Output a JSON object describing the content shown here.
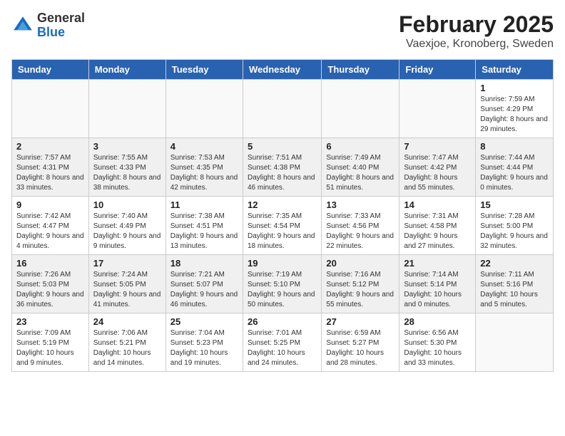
{
  "logo": {
    "general": "General",
    "blue": "Blue"
  },
  "title": "February 2025",
  "subtitle": "Vaexjoe, Kronoberg, Sweden",
  "headers": [
    "Sunday",
    "Monday",
    "Tuesday",
    "Wednesday",
    "Thursday",
    "Friday",
    "Saturday"
  ],
  "weeks": [
    [
      {
        "day": "",
        "info": ""
      },
      {
        "day": "",
        "info": ""
      },
      {
        "day": "",
        "info": ""
      },
      {
        "day": "",
        "info": ""
      },
      {
        "day": "",
        "info": ""
      },
      {
        "day": "",
        "info": ""
      },
      {
        "day": "1",
        "info": "Sunrise: 7:59 AM\nSunset: 4:29 PM\nDaylight: 8 hours and 29 minutes."
      }
    ],
    [
      {
        "day": "2",
        "info": "Sunrise: 7:57 AM\nSunset: 4:31 PM\nDaylight: 8 hours and 33 minutes."
      },
      {
        "day": "3",
        "info": "Sunrise: 7:55 AM\nSunset: 4:33 PM\nDaylight: 8 hours and 38 minutes."
      },
      {
        "day": "4",
        "info": "Sunrise: 7:53 AM\nSunset: 4:35 PM\nDaylight: 8 hours and 42 minutes."
      },
      {
        "day": "5",
        "info": "Sunrise: 7:51 AM\nSunset: 4:38 PM\nDaylight: 8 hours and 46 minutes."
      },
      {
        "day": "6",
        "info": "Sunrise: 7:49 AM\nSunset: 4:40 PM\nDaylight: 8 hours and 51 minutes."
      },
      {
        "day": "7",
        "info": "Sunrise: 7:47 AM\nSunset: 4:42 PM\nDaylight: 8 hours and 55 minutes."
      },
      {
        "day": "8",
        "info": "Sunrise: 7:44 AM\nSunset: 4:44 PM\nDaylight: 9 hours and 0 minutes."
      }
    ],
    [
      {
        "day": "9",
        "info": "Sunrise: 7:42 AM\nSunset: 4:47 PM\nDaylight: 9 hours and 4 minutes."
      },
      {
        "day": "10",
        "info": "Sunrise: 7:40 AM\nSunset: 4:49 PM\nDaylight: 9 hours and 9 minutes."
      },
      {
        "day": "11",
        "info": "Sunrise: 7:38 AM\nSunset: 4:51 PM\nDaylight: 9 hours and 13 minutes."
      },
      {
        "day": "12",
        "info": "Sunrise: 7:35 AM\nSunset: 4:54 PM\nDaylight: 9 hours and 18 minutes."
      },
      {
        "day": "13",
        "info": "Sunrise: 7:33 AM\nSunset: 4:56 PM\nDaylight: 9 hours and 22 minutes."
      },
      {
        "day": "14",
        "info": "Sunrise: 7:31 AM\nSunset: 4:58 PM\nDaylight: 9 hours and 27 minutes."
      },
      {
        "day": "15",
        "info": "Sunrise: 7:28 AM\nSunset: 5:00 PM\nDaylight: 9 hours and 32 minutes."
      }
    ],
    [
      {
        "day": "16",
        "info": "Sunrise: 7:26 AM\nSunset: 5:03 PM\nDaylight: 9 hours and 36 minutes."
      },
      {
        "day": "17",
        "info": "Sunrise: 7:24 AM\nSunset: 5:05 PM\nDaylight: 9 hours and 41 minutes."
      },
      {
        "day": "18",
        "info": "Sunrise: 7:21 AM\nSunset: 5:07 PM\nDaylight: 9 hours and 46 minutes."
      },
      {
        "day": "19",
        "info": "Sunrise: 7:19 AM\nSunset: 5:10 PM\nDaylight: 9 hours and 50 minutes."
      },
      {
        "day": "20",
        "info": "Sunrise: 7:16 AM\nSunset: 5:12 PM\nDaylight: 9 hours and 55 minutes."
      },
      {
        "day": "21",
        "info": "Sunrise: 7:14 AM\nSunset: 5:14 PM\nDaylight: 10 hours and 0 minutes."
      },
      {
        "day": "22",
        "info": "Sunrise: 7:11 AM\nSunset: 5:16 PM\nDaylight: 10 hours and 5 minutes."
      }
    ],
    [
      {
        "day": "23",
        "info": "Sunrise: 7:09 AM\nSunset: 5:19 PM\nDaylight: 10 hours and 9 minutes."
      },
      {
        "day": "24",
        "info": "Sunrise: 7:06 AM\nSunset: 5:21 PM\nDaylight: 10 hours and 14 minutes."
      },
      {
        "day": "25",
        "info": "Sunrise: 7:04 AM\nSunset: 5:23 PM\nDaylight: 10 hours and 19 minutes."
      },
      {
        "day": "26",
        "info": "Sunrise: 7:01 AM\nSunset: 5:25 PM\nDaylight: 10 hours and 24 minutes."
      },
      {
        "day": "27",
        "info": "Sunrise: 6:59 AM\nSunset: 5:27 PM\nDaylight: 10 hours and 28 minutes."
      },
      {
        "day": "28",
        "info": "Sunrise: 6:56 AM\nSunset: 5:30 PM\nDaylight: 10 hours and 33 minutes."
      },
      {
        "day": "",
        "info": ""
      }
    ]
  ]
}
